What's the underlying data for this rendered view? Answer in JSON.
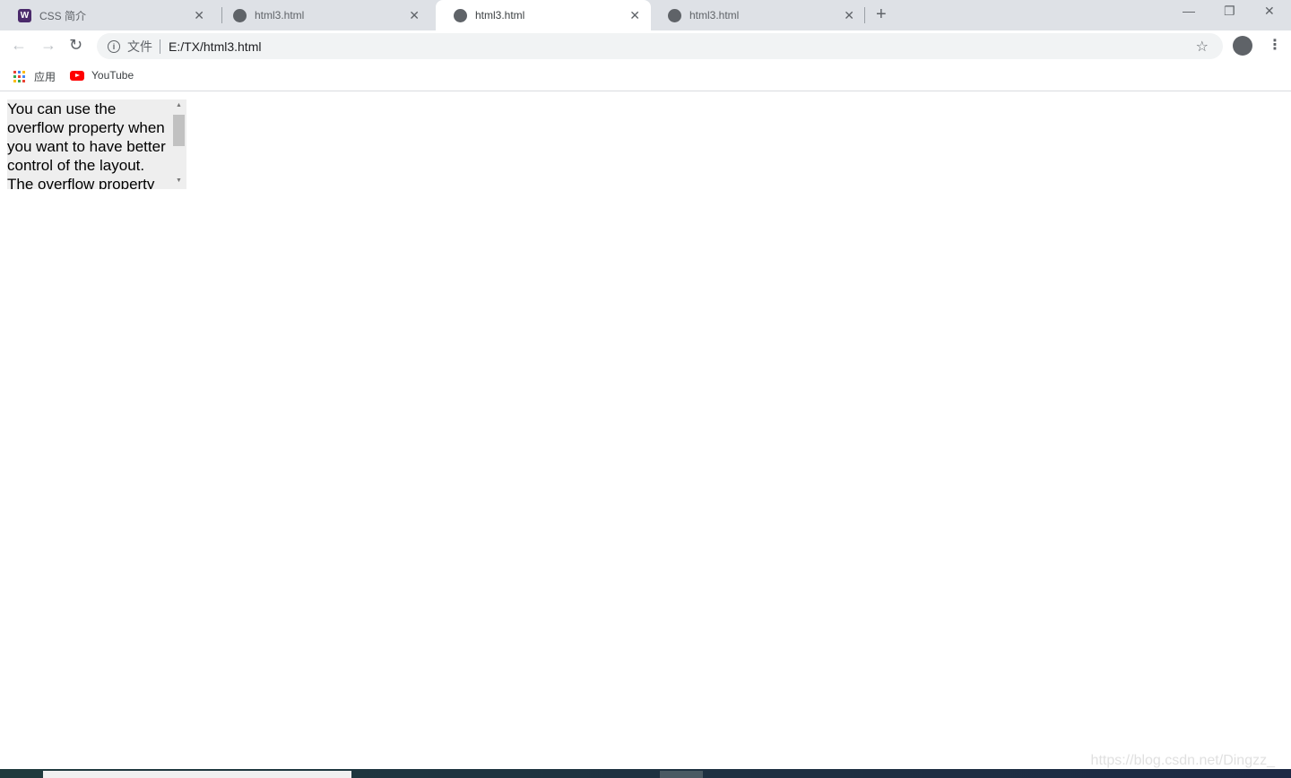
{
  "tabs": [
    {
      "title": "CSS 简介",
      "icon": "w3schools-icon",
      "active": false
    },
    {
      "title": "html3.html",
      "icon": "globe-icon",
      "active": false
    },
    {
      "title": "html3.html",
      "icon": "globe-icon",
      "active": true
    },
    {
      "title": "html3.html",
      "icon": "globe-icon",
      "active": false
    }
  ],
  "favicon_letter": "W",
  "address": {
    "security_label": "文件",
    "url": "E:/TX/html3.html"
  },
  "bookmarks": [
    {
      "label": "应用",
      "icon": "apps-icon"
    },
    {
      "label": "YouTube",
      "icon": "youtube-icon"
    }
  ],
  "content": {
    "text": "You can use the overflow property when you want to have better control of the layout. The overflow property specifies what happens if content overflows an element's box."
  },
  "watermark": "https://blog.csdn.net/Dingzz_"
}
